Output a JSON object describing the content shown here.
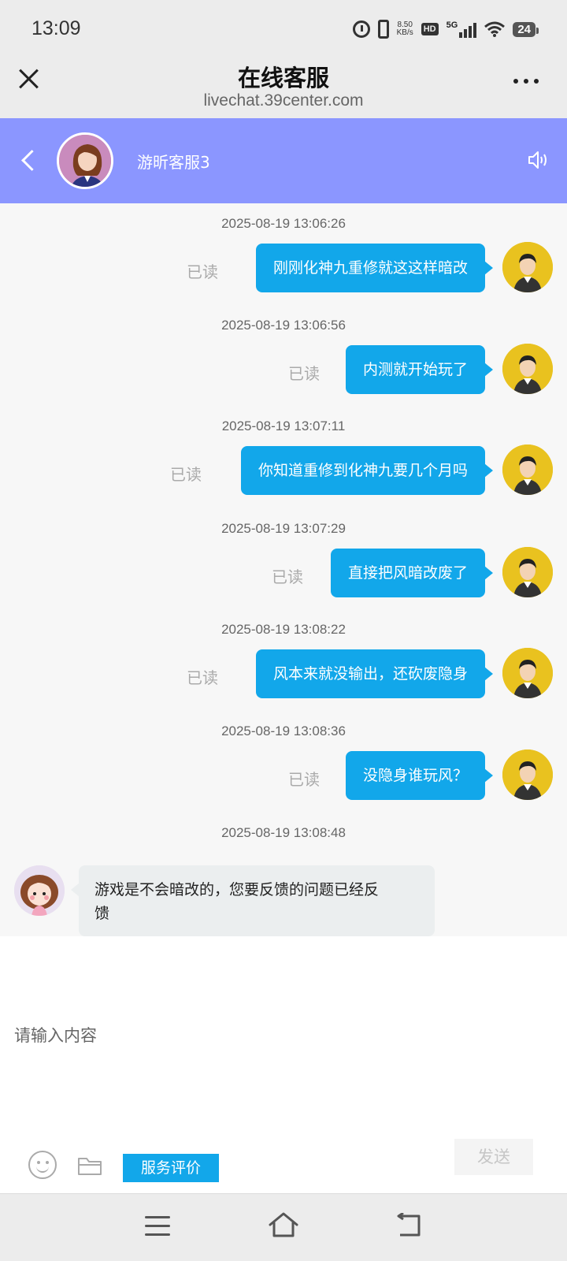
{
  "status_bar": {
    "time": "13:09",
    "net_speed_value": "8.50",
    "net_speed_unit": "KB/s",
    "hd_label": "HD",
    "network_label": "5G",
    "battery": "24"
  },
  "browser": {
    "title": "在线客服",
    "url": "livechat.39center.com"
  },
  "chat_header": {
    "agent_name": "游昕客服3"
  },
  "read_label": "已读",
  "messages": [
    {
      "time": "2025-08-19 13:06:26",
      "text": "刚刚化神九重修就这这样暗改"
    },
    {
      "time": "2025-08-19 13:06:56",
      "text": "内测就开始玩了"
    },
    {
      "time": "2025-08-19 13:07:11",
      "text": "你知道重修到化神九要几个月吗"
    },
    {
      "time": "2025-08-19 13:07:29",
      "text": "直接把风暗改废了"
    },
    {
      "time": "2025-08-19 13:08:22",
      "text": "风本来就没输出，还砍废隐身"
    },
    {
      "time": "2025-08-19 13:08:36",
      "text": "没隐身谁玩风？"
    }
  ],
  "incoming": {
    "time": "2025-08-19 13:08:48",
    "line1": "游戏是不会暗改的，您要反馈的问题已经反",
    "line2": "馈"
  },
  "composer": {
    "placeholder": "请输入内容",
    "rate_label": "服务评价",
    "send_label": "发送"
  },
  "colors": {
    "chat_header_bg": "#8b96ff",
    "bubble_out": "#12a7ea",
    "bubble_in": "#ebeeef"
  }
}
